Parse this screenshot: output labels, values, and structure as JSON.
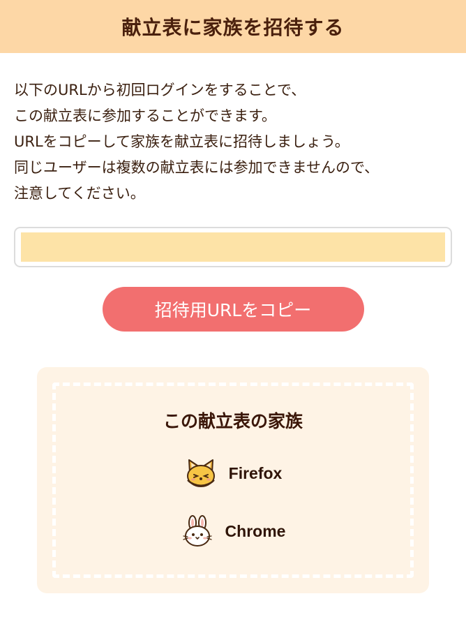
{
  "header": {
    "title": "献立表に家族を招待する"
  },
  "description": {
    "lines": [
      "以下のURLから初回ログインをすることで、",
      "この献立表に参加することができます。",
      "URLをコピーして家族を献立表に招待しましょう。",
      "同じユーザーは複数の献立表には参加できませんので、",
      "注意してください。"
    ]
  },
  "invite": {
    "url_value": "",
    "copy_button_label": "招待用URLをコピー"
  },
  "family": {
    "title": "この献立表の家族",
    "members": [
      {
        "name": "Firefox",
        "icon": "fox-icon"
      },
      {
        "name": "Chrome",
        "icon": "rabbit-icon"
      }
    ]
  },
  "colors": {
    "header_bg": "#fdd7a6",
    "url_highlight": "#fde3a7",
    "copy_button": "#f26f6f",
    "card_bg": "#fef3e5"
  }
}
